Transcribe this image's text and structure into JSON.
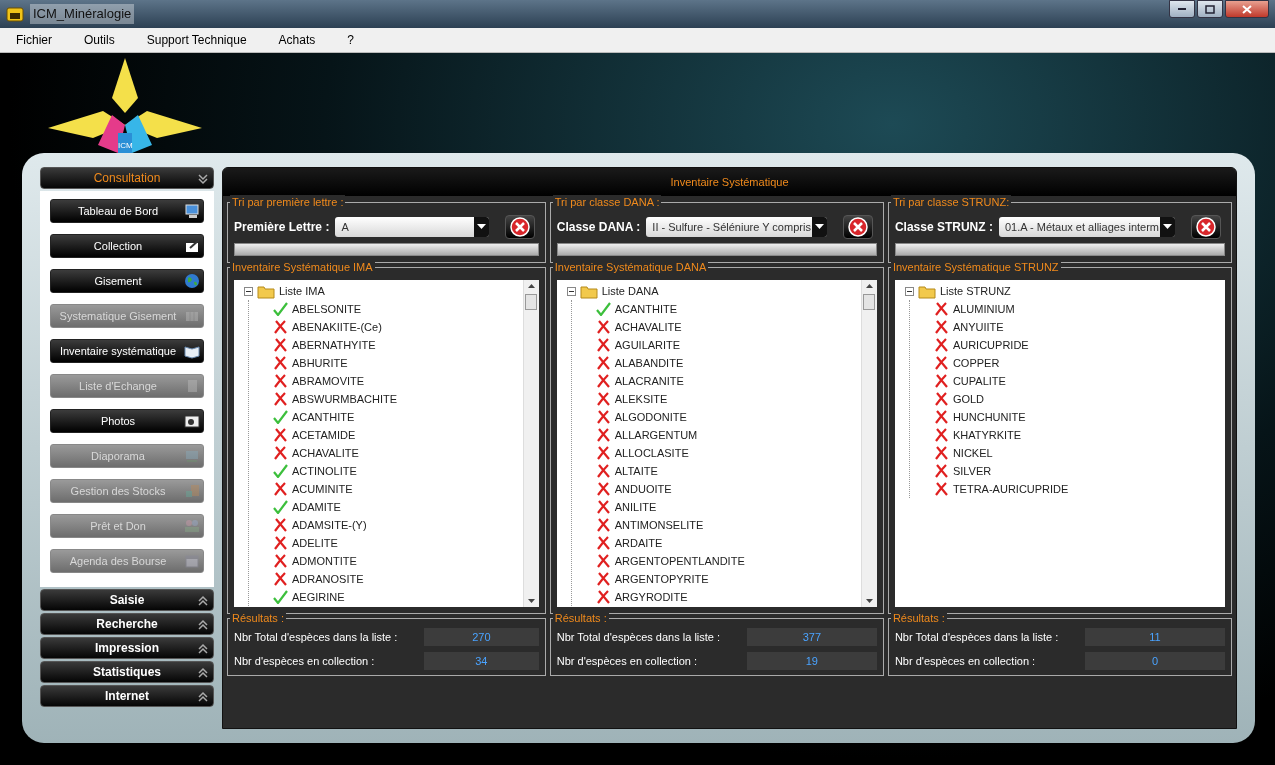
{
  "window": {
    "title": "ICM_Minéralogie"
  },
  "menu": [
    "Fichier",
    "Outils",
    "Support Technique",
    "Achats",
    "?"
  ],
  "logo": {
    "text": "ICM"
  },
  "sidebar": [
    {
      "label": "Consultation",
      "expanded": true,
      "items": [
        {
          "label": "Tableau de Bord",
          "enabled": true
        },
        {
          "label": "Collection",
          "enabled": true
        },
        {
          "label": "Gisement",
          "enabled": true
        },
        {
          "label": "Systematique Gisement",
          "enabled": false
        },
        {
          "label": "Inventaire systématique",
          "enabled": true
        },
        {
          "label": "Liste d'Echange",
          "enabled": false
        },
        {
          "label": "Photos",
          "enabled": true
        },
        {
          "label": "Diaporama",
          "enabled": false
        },
        {
          "label": "Gestion des Stocks",
          "enabled": false
        },
        {
          "label": "Prêt et Don",
          "enabled": false
        },
        {
          "label": "Agenda des Bourse",
          "enabled": false
        }
      ]
    },
    {
      "label": "Saisie",
      "expanded": false
    },
    {
      "label": "Recherche",
      "expanded": false
    },
    {
      "label": "Impression",
      "expanded": false
    },
    {
      "label": "Statistiques",
      "expanded": false
    },
    {
      "label": "Internet",
      "expanded": false
    }
  ],
  "panel_title": "Inventaire Systématique",
  "columns": [
    {
      "filter": {
        "legend": "Tri par première lettre :",
        "label": "Première Lettre :",
        "value": "A",
        "progress": {
          "level": 0
        }
      },
      "tree": {
        "legend": "Inventaire Systématique IMA",
        "scrollbar": true,
        "root": {
          "label": "Liste IMA",
          "expanded": true,
          "children": [
            {
              "label": "ABELSONITE",
              "owned": true
            },
            {
              "label": "ABENAKIITE-(Ce)",
              "owned": false
            },
            {
              "label": "ABERNATHYITE",
              "owned": false
            },
            {
              "label": "ABHURITE",
              "owned": false
            },
            {
              "label": "ABRAMOVITE",
              "owned": false
            },
            {
              "label": "ABSWURMBACHITE",
              "owned": false
            },
            {
              "label": "ACANTHITE",
              "owned": true
            },
            {
              "label": "ACETAMIDE",
              "owned": false
            },
            {
              "label": "ACHAVALITE",
              "owned": false
            },
            {
              "label": "ACTINOLITE",
              "owned": true
            },
            {
              "label": "ACUMINITE",
              "owned": false
            },
            {
              "label": "ADAMITE",
              "owned": true
            },
            {
              "label": "ADAMSITE-(Y)",
              "owned": false
            },
            {
              "label": "ADELITE",
              "owned": false
            },
            {
              "label": "ADMONTITE",
              "owned": false
            },
            {
              "label": "ADRANOSITE",
              "owned": false
            },
            {
              "label": "AEGIRINE",
              "owned": true
            }
          ]
        }
      },
      "results": {
        "legend": "Résultats :",
        "rows": [
          {
            "label": "Nbr Total d'espèces dans la liste :",
            "value": "270"
          },
          {
            "label": "Nbr d'espèces en collection :",
            "value": "34"
          }
        ]
      }
    },
    {
      "filter": {
        "legend": "Tri par classe DANA :",
        "label": "Classe DANA :",
        "value": "II - Sulfure - Séléniure Y compris",
        "progress": {
          "level": 0
        }
      },
      "tree": {
        "legend": "Inventaire Systématique DANA",
        "scrollbar": true,
        "root": {
          "label": "Liste DANA",
          "expanded": true,
          "children": [
            {
              "label": "ACANTHITE",
              "owned": true
            },
            {
              "label": "ACHAVALITE",
              "owned": false
            },
            {
              "label": "AGUILARITE",
              "owned": false
            },
            {
              "label": "ALABANDITE",
              "owned": false
            },
            {
              "label": "ALACRANITE",
              "owned": false
            },
            {
              "label": "ALEKSITE",
              "owned": false
            },
            {
              "label": "ALGODONITE",
              "owned": false
            },
            {
              "label": "ALLARGENTUM",
              "owned": false
            },
            {
              "label": "ALLOCLASITE",
              "owned": false
            },
            {
              "label": "ALTAITE",
              "owned": false
            },
            {
              "label": "ANDUOITE",
              "owned": false
            },
            {
              "label": "ANILITE",
              "owned": false
            },
            {
              "label": "ANTIMONSELITE",
              "owned": false
            },
            {
              "label": "ARDAITE",
              "owned": false
            },
            {
              "label": "ARGENTOPENTLANDITE",
              "owned": false
            },
            {
              "label": "ARGENTOPYRITE",
              "owned": false
            },
            {
              "label": "ARGYRODITE",
              "owned": false
            }
          ]
        }
      },
      "results": {
        "legend": "Résultats :",
        "rows": [
          {
            "label": "Nbr Total d'espèces dans la liste :",
            "value": "377"
          },
          {
            "label": "Nbr d'espèces en collection :",
            "value": "19"
          }
        ]
      }
    },
    {
      "filter": {
        "legend": "Tri par classe STRUNZ:",
        "label": "Classe STRUNZ :",
        "value": "01.A - Métaux et alliages interm",
        "progress": {
          "level": 0
        }
      },
      "tree": {
        "legend": "Inventaire Systématique STRUNZ",
        "scrollbar": false,
        "root": {
          "label": "Liste STRUNZ",
          "expanded": true,
          "children": [
            {
              "label": "ALUMINIUM",
              "owned": false
            },
            {
              "label": "ANYUIITE",
              "owned": false
            },
            {
              "label": "AURICUPRIDE",
              "owned": false
            },
            {
              "label": "COPPER",
              "owned": false
            },
            {
              "label": "CUPALITE",
              "owned": false
            },
            {
              "label": "GOLD",
              "owned": false
            },
            {
              "label": "HUNCHUNITE",
              "owned": false
            },
            {
              "label": "KHATYRKITE",
              "owned": false
            },
            {
              "label": "NICKEL",
              "owned": false
            },
            {
              "label": "SILVER",
              "owned": false
            },
            {
              "label": "TETRA-AURICUPRIDE",
              "owned": false
            }
          ]
        }
      },
      "results": {
        "legend": "Résultats :",
        "rows": [
          {
            "label": "Nbr Total d'espèces dans la liste :",
            "value": "11"
          },
          {
            "label": "Nbr d'espèces en collection :",
            "value": "0"
          }
        ]
      }
    }
  ]
}
